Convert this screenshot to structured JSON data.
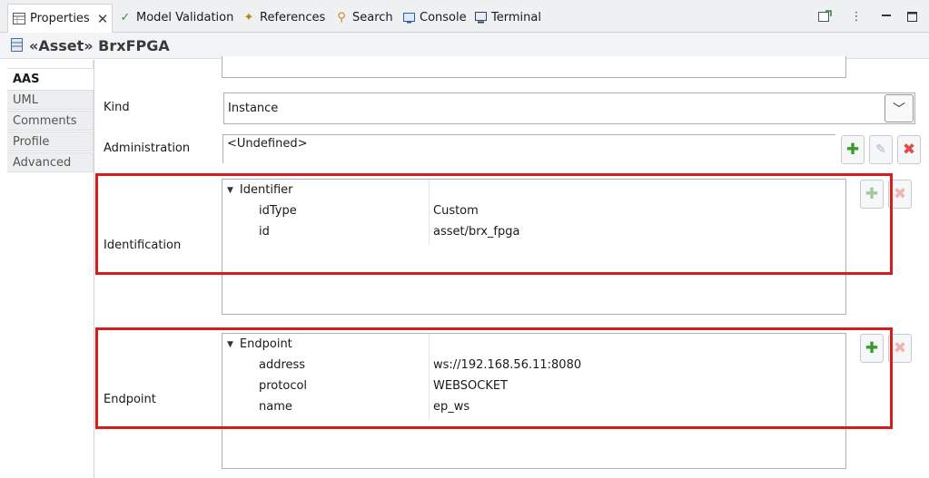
{
  "tabs": [
    {
      "label": "Properties",
      "icon": "properties-icon"
    },
    {
      "label": "Model Validation",
      "icon": "checkmark-icon"
    },
    {
      "label": "References",
      "icon": "references-icon"
    },
    {
      "label": "Search",
      "icon": "search-icon"
    },
    {
      "label": "Console",
      "icon": "console-icon"
    },
    {
      "label": "Terminal",
      "icon": "terminal-icon"
    }
  ],
  "title": "«Asset» BrxFPGA",
  "categories": [
    "AAS",
    "UML",
    "Comments",
    "Profile",
    "Advanced"
  ],
  "form": {
    "kind_label": "Kind",
    "kind_value": "Instance",
    "administration_label": "Administration",
    "administration_value": "<Undefined>",
    "identification_label": "Identification",
    "identification": {
      "root": "Identifier",
      "rows": [
        {
          "key": "idType",
          "value": "Custom"
        },
        {
          "key": "id",
          "value": "asset/brx_fpga"
        }
      ]
    },
    "endpoint_label": "Endpoint",
    "endpoint": {
      "root": "Endpoint",
      "rows": [
        {
          "key": "address",
          "value": "ws://192.168.56.11:8080"
        },
        {
          "key": "protocol",
          "value": "WEBSOCKET"
        },
        {
          "key": "name",
          "value": "ep_ws"
        }
      ]
    }
  },
  "colors": {
    "highlight": "#d61c1c",
    "add": "#3a9b2b",
    "remove": "#e04a4a"
  }
}
